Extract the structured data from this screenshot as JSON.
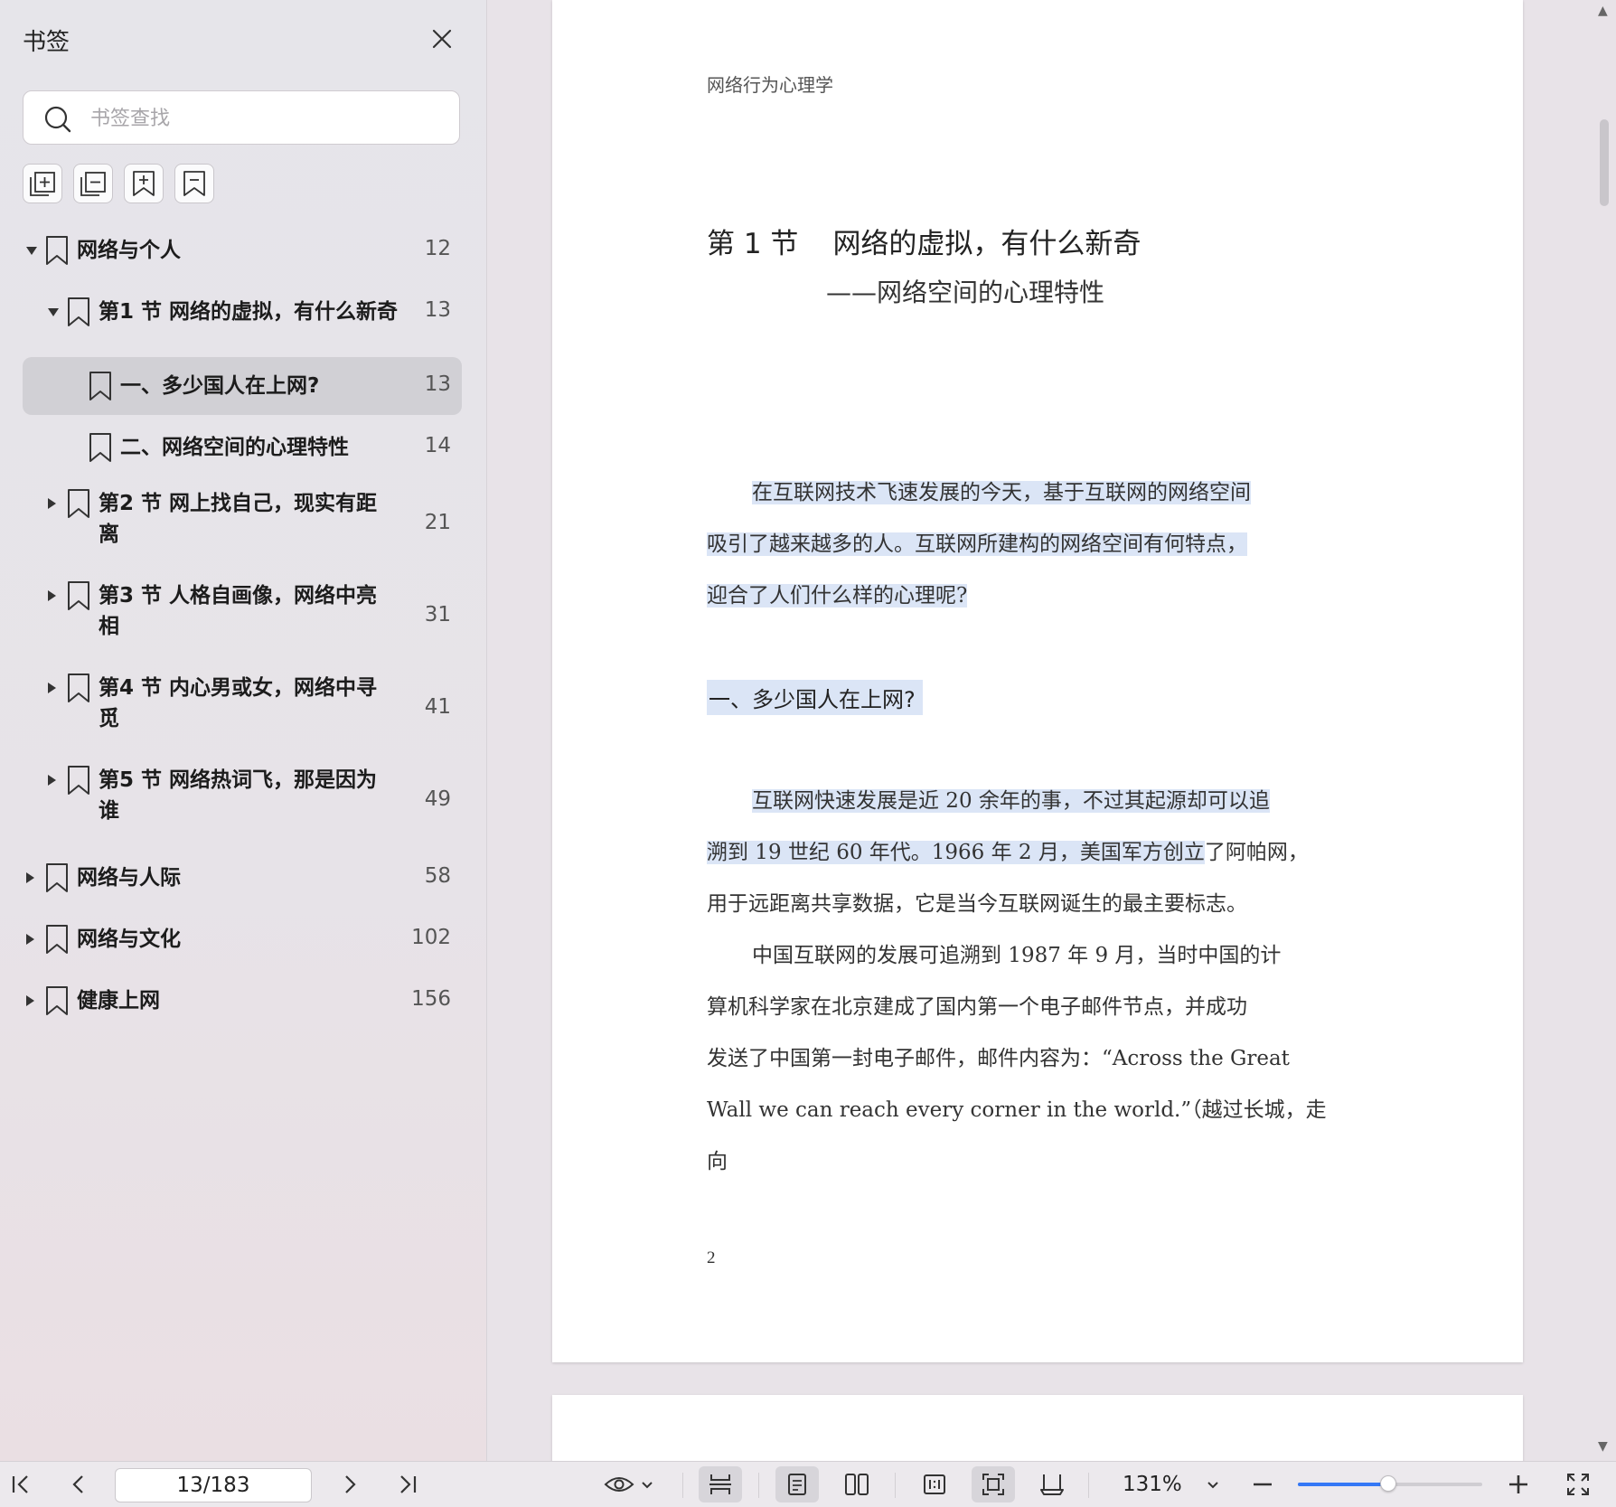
{
  "sidebar": {
    "title": "书签",
    "search_placeholder": "书签查找",
    "tools": [
      "expand-all-icon",
      "collapse-all-icon",
      "add-bookmark-icon",
      "delete-bookmark-icon"
    ],
    "items": [
      {
        "label": "网络与个人",
        "page": "12",
        "level": 0,
        "expand": "open"
      },
      {
        "label": "第1 节 网络的虚拟，有什么新奇",
        "page": "13",
        "level": 1,
        "expand": "open"
      },
      {
        "label": "一、多少国人在上网?",
        "page": "13",
        "level": 2,
        "expand": "none",
        "selected": true
      },
      {
        "label": "二、网络空间的心理特性",
        "page": "14",
        "level": 2,
        "expand": "none"
      },
      {
        "label": "第2 节 网上找自己，现实有距离",
        "label_lines": [
          "第2 节 网上找自己，现实有距",
          "离"
        ],
        "page": "21",
        "level": 1,
        "expand": "closed"
      },
      {
        "label": "第3 节 人格自画像，网络中亮相",
        "label_lines": [
          "第3 节 人格自画像，网络中亮",
          "相"
        ],
        "page": "31",
        "level": 1,
        "expand": "closed"
      },
      {
        "label": "第4 节 内心男或女，网络中寻觅",
        "label_lines": [
          "第4 节 内心男或女，网络中寻",
          "觅"
        ],
        "page": "41",
        "level": 1,
        "expand": "closed"
      },
      {
        "label": "第5 节 网络热词飞，那是因为谁",
        "label_lines": [
          "第5 节 网络热词飞，那是因为",
          "谁"
        ],
        "page": "49",
        "level": 1,
        "expand": "closed"
      },
      {
        "label": "网络与人际",
        "page": "58",
        "level": 0,
        "expand": "closed"
      },
      {
        "label": "网络与文化",
        "page": "102",
        "level": 0,
        "expand": "closed"
      },
      {
        "label": "健康上网",
        "page": "156",
        "level": 0,
        "expand": "closed"
      }
    ]
  },
  "document": {
    "running_head": "网络行为心理学",
    "chapter_num": "第 1 节",
    "chapter_title": "网络的虚拟，有什么新奇",
    "subtitle": "——网络空间的心理特性",
    "intro_lines": [
      "在互联网技术飞速发展的今天，基于互联网的网络空间",
      "吸引了越来越多的人。互联网所建构的网络空间有何特点，",
      "迎合了人们什么样的心理呢?"
    ],
    "section_heading": "一、多少国人在上网?",
    "para1_lines": [
      "互联网快速发展是近 20 余年的事，不过其起源却可以追",
      "溯到 19 世纪 60 年代。1966 年 2 月，美国军方创立",
      "了阿帕网，",
      "用于远距离共享数据，它是当今互联网诞生的最主要标志。"
    ],
    "para2_lines": [
      "中国互联网的发展可追溯到 1987 年 9 月，当时中国的计",
      "算机科学家在北京建成了国内第一个电子邮件节点，并成功",
      "发送了中国第一封电子邮件，邮件内容为：“Across the Great",
      "Wall we can reach every corner in the world.”（越过长城，走向"
    ],
    "page_number": "2"
  },
  "bottombar": {
    "page_indicator": "13/183",
    "zoom": "131%",
    "zoom_level": 0.49
  }
}
